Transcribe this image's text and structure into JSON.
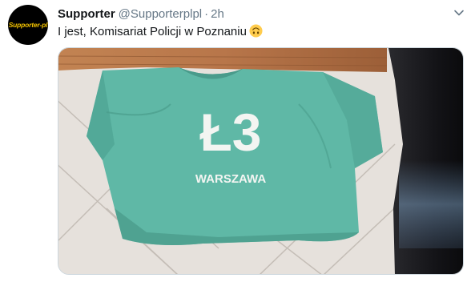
{
  "tweet": {
    "display_name": "Supporter",
    "handle": "@Supporterplpl",
    "separator": "·",
    "time": "2h",
    "text": "I jest, Komisariat Policji w Poznaniu",
    "emoji_icon": "upside-down-face-emoji"
  },
  "avatar": {
    "label": "Supporter-pl",
    "text_color": "#f2c200",
    "background": "#000000"
  },
  "media": {
    "shirt_big_text": "Ł3",
    "shirt_small_text": "WARSZAWA",
    "shirt_color": "#5fb8a6"
  },
  "icons": {
    "menu": "chevron-down-icon"
  }
}
